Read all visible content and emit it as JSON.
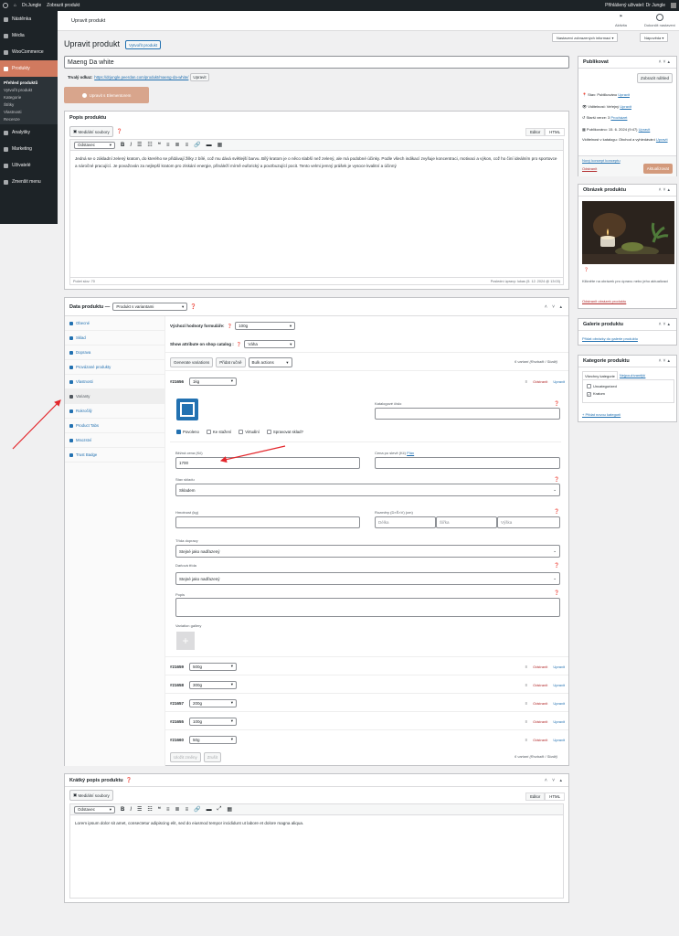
{
  "adminbar": {
    "site": "Dr.Jungle",
    "view": "Zobrazit produkt",
    "user": "Přihlášený uživatel: Dr Jungle"
  },
  "sidebar": {
    "items": [
      {
        "label": "Nástěnka",
        "icon": "dashboard-icon"
      },
      {
        "label": "Média",
        "icon": "media-icon"
      },
      {
        "label": "WooCommerce",
        "icon": "woocommerce-icon"
      },
      {
        "label": "Produkty",
        "icon": "products-icon"
      }
    ],
    "sub": [
      "Přehled produktů",
      "Vytvořit produkt",
      "Kategorie",
      "Štítky",
      "Vlastnosti",
      "Recenze"
    ],
    "items2": [
      {
        "label": "Analytiky",
        "icon": "analytics-icon"
      },
      {
        "label": "Marketing",
        "icon": "marketing-icon"
      },
      {
        "label": "Uživatelé",
        "icon": "users-icon"
      },
      {
        "label": "Zmenšit menu",
        "icon": "collapse-icon"
      }
    ]
  },
  "header": {
    "title": "Upravit produkt",
    "activity": "Aktivita",
    "finish": "Dokončit nastavení",
    "screen_options": "Nastavení zobrazených informací ▾",
    "help": "Nápověda ▾"
  },
  "page": {
    "title": "Upravit produkt",
    "add_new": "Vytvořit produkt",
    "product_name": "Maeng Da white",
    "permalink_label": "Trvalý odkaz:",
    "permalink": "https://drjungle.peerdan.com/produkt/maeng-da-white/",
    "permalink_btn": "Upravit",
    "elementor": "Upravit s Elementorem"
  },
  "desc": {
    "title": "Popis produktu",
    "media": "Mediální soubory",
    "editor": "Editor",
    "html": "HTML",
    "format": "Odstavec",
    "text": "Jedná se o základní zelený kratom, do kterého se přidávají žilky z bílé, což mu dává světlejší barvu. Bílý kratom je o něco slabší než zelený, ale má podobné účinky. Podle všech indikací zvyšuje koncentraci, motivaci a výkon, což ho činí ideálním pro sportovce a náročné pracující. Je považován za nejlepší kratom pro získání energie, přináleží mírně euforický a povzbuzující pocit. Tento velmi jemný prášek je vysoce kvalitní a účinný",
    "words": "Počet slov: 70",
    "last_edit": "Poslední úpravy: lukas (5. 12. 2024 @ 13:03)"
  },
  "data": {
    "title": "Data produktu —",
    "type": "Produkt s variantami",
    "tabs": [
      "Obecné",
      "Sklad",
      "Doprava",
      "Provázané produkty",
      "Vlastnosti",
      "Varianty",
      "Rokročilý",
      "Product Tabs",
      "Mnozství",
      "Trust Badge"
    ],
    "default_label": "Výchozí hodnoty formuláře:",
    "default_val": "100g",
    "show_attr_label": "Show attribute on shop catalog :",
    "show_attr_val": "Váha",
    "gen_btn": "Generate variations",
    "add_btn": "Přidat ručně",
    "bulk": "Bulk actions",
    "count": "6 variant (Rozbalit / Sbalit)",
    "variations": [
      {
        "id": "#21656",
        "val": "1kg"
      },
      {
        "id": "#21659",
        "val": "500g"
      },
      {
        "id": "#21658",
        "val": "300g"
      },
      {
        "id": "#21657",
        "val": "200g"
      },
      {
        "id": "#21655",
        "val": "100g"
      },
      {
        "id": "#21660",
        "val": "50g"
      }
    ],
    "remove": "Odstranit",
    "edit": "Upravit",
    "sku_label": "Katalogové číslo",
    "enabled": "Povoleno",
    "downloadable": "Ke stažení",
    "virtual": "Virtuální",
    "manage_stock": "Spravovat sklad?",
    "price_label": "Běžná cena (Kč)",
    "price": "1700",
    "sale_label": "Cena po slevě (Kč)",
    "sale_link": "Plán",
    "stock_label": "Stav skladu",
    "stock": "Skladem",
    "weight_label": "Hmotnost (kg)",
    "dims_label": "Rozměry (D×Š×V) (cm)",
    "d": "Délka",
    "w": "Šířka",
    "h": "Výška",
    "ship_label": "Třída dopravy",
    "ship": "Stejné jako nadřazený",
    "tax_label": "Daňová třída",
    "tax": "Stejné jako nadřazený",
    "desc_label": "Popis",
    "gallery": "Variation gallery",
    "save": "Uložit změny",
    "cancel": "Zrušit"
  },
  "short": {
    "title": "Krátký popis produktu",
    "media": "Mediální soubory",
    "editor": "Editor",
    "html": "HTML",
    "format": "Odstavec",
    "text": "Lorem ipsum dolor sit amet, consectetur adipiscing elit, sed do eiusmod tempor incididunt ut labore et dolore magna aliqua."
  },
  "publish": {
    "title": "Publikovat",
    "preview": "Zobrazit náhled",
    "status": "Stav: Publikováno",
    "status_link": "Upravit",
    "vis": "Viditelnost: Veřejný",
    "vis_link": "Upravit",
    "rev": "Starší verze: 3",
    "rev_link": "Procházet",
    "date": "Publikováno: 15. 6. 2024 (9:47)",
    "date_link": "Upravit",
    "catalog": "Viditelnost v katalogu: Obchod a vyhledávání",
    "catalog_link": "Upravit",
    "draft": "Nový koncept konceptu",
    "trash": "Odstranit",
    "update": "Aktualizovat"
  },
  "image": {
    "title": "Obrázek produktu",
    "hint": "Klikněte na obrázek pro úpravu nebo jeho aktualizaci",
    "remove": "Odstranit obrázek produktu"
  },
  "gallery": {
    "title": "Galerie produktu",
    "add": "Přidat obrázky do galerie produktu"
  },
  "cats": {
    "title": "Kategorie produktu",
    "tab_all": "Všechny kategorie",
    "tab_pop": "Nejpoužívanější",
    "items": [
      "Uncategorized",
      "Kratom"
    ],
    "add": "+ Přidat novou kategorii"
  }
}
